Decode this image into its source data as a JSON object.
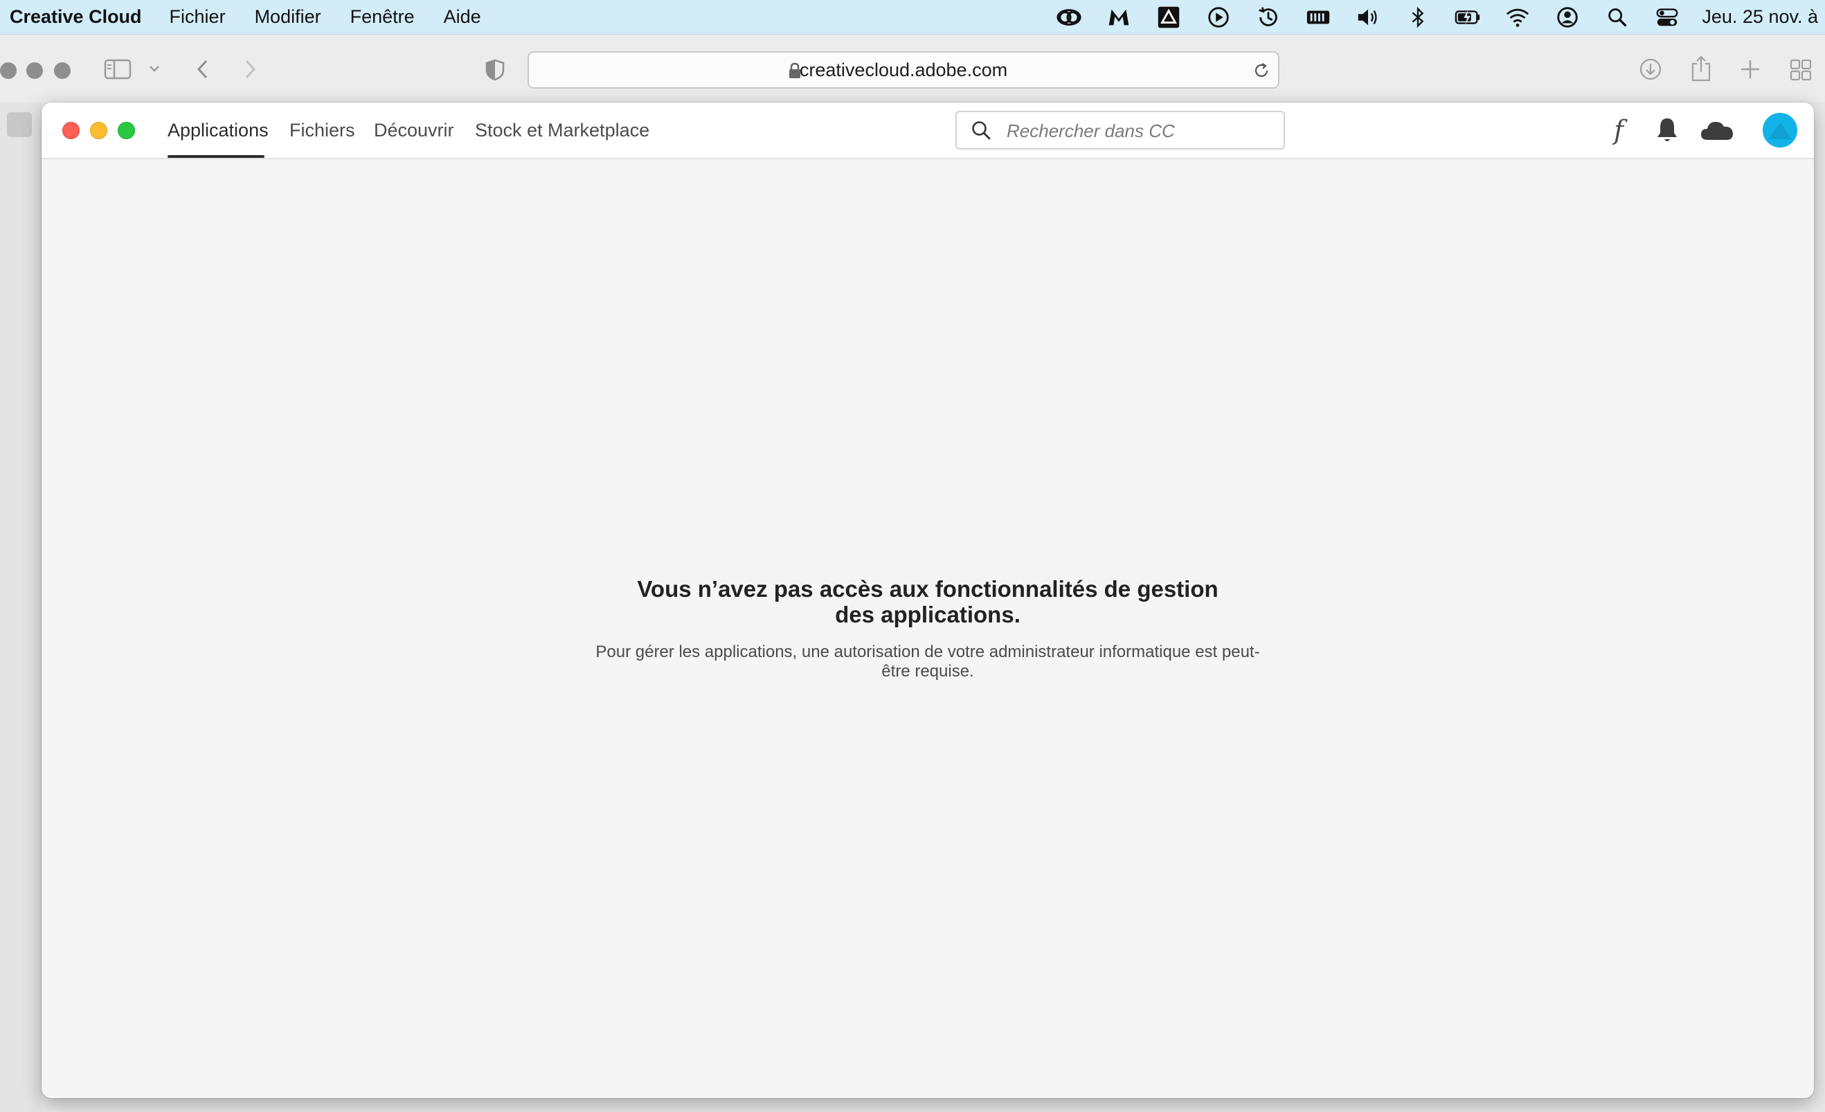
{
  "menubar": {
    "app_name": "Creative Cloud",
    "items": [
      "Fichier",
      "Modifier",
      "Fenêtre",
      "Aide"
    ],
    "status_icons": [
      "creative-cloud-icon",
      "malwarebytes-icon",
      "drive-icon",
      "play-icon",
      "time-machine-icon",
      "memory-icon",
      "volume-icon",
      "bluetooth-icon",
      "battery-icon",
      "wifi-icon",
      "user-icon",
      "spotlight-icon",
      "control-center-icon"
    ],
    "clock": "Jeu. 25 nov. à"
  },
  "browser": {
    "url": "creativecloud.adobe.com"
  },
  "cc": {
    "tabs": [
      "Applications",
      "Fichiers",
      "Découvrir",
      "Stock et Marketplace"
    ],
    "active_tab": "Applications",
    "search_placeholder": "Rechercher dans CC",
    "fonts_glyph": "f",
    "accent_color": "#12b3e8"
  },
  "message": {
    "title": "Vous n’avez pas accès aux fonctionnalités de gestion des applications.",
    "body": "Pour gérer les applications, une autorisation de votre administrateur informatique est peut-être requise."
  }
}
